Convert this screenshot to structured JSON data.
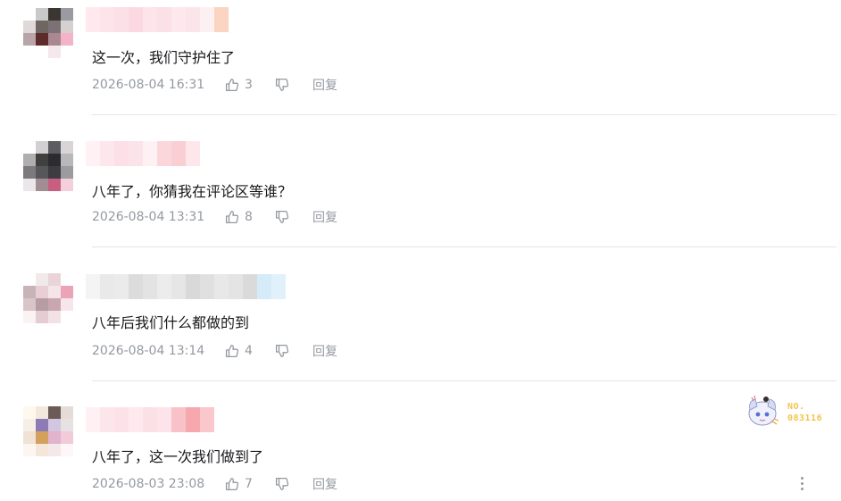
{
  "comments": [
    {
      "text": "这一次，我们守护住了",
      "time": "2026-08-04 16:31",
      "likes": "3",
      "reply_label": "回复",
      "avatar_colors": [
        "#ffffff",
        "#c9c9c9",
        "#3b3631",
        "#9a9ba0",
        "#e0d9d9",
        "#6d6661",
        "#7c7276",
        "#d6d0d1",
        "#b7a5aa",
        "#5d2c2a",
        "#a98891",
        "#f3b4c9",
        "#ffffff",
        "#ffffff",
        "#f5e8ec",
        "#ffffff"
      ],
      "name_colors": [
        "#ffe9ee",
        "#fde4ea",
        "#fbe0e8",
        "#fcd9e2",
        "#fde3ea",
        "#fce0e7",
        "#fde8ec",
        "#fbe4ea",
        "#fdf0f2",
        "#fbd4c2"
      ]
    },
    {
      "text": "八年了，你猜我在评论区等谁？",
      "time": "2026-08-04 13:31",
      "likes": "8",
      "reply_label": "回复",
      "avatar_colors": [
        "#ffffff",
        "#d2d0d2",
        "#5d5d61",
        "#d9d5d7",
        "#b0aeb1",
        "#40403f",
        "#2c2c30",
        "#b8b8ba",
        "#7c7a7d",
        "#56575a",
        "#3d3c40",
        "#9c9b9e",
        "#eae6e9",
        "#a18e93",
        "#c75f80",
        "#f4cfdc"
      ],
      "name_colors": [
        "#fff1f4",
        "#fde6ec",
        "#fcdfe7",
        "#fbe3ea",
        "#fdf1f4",
        "#fbd7dc",
        "#f9cfd4",
        "#fde7ea"
      ]
    },
    {
      "text": "八年后我们什么都做的到",
      "time": "2026-08-04 13:14",
      "likes": "4",
      "reply_label": "回复",
      "avatar_colors": [
        "#ffffff",
        "#f2e9eb",
        "#ebd3da",
        "#ffffff",
        "#c7b4b9",
        "#e7cfd5",
        "#f3e5e9",
        "#eba3b8",
        "#d9c4c8",
        "#b79ca3",
        "#c8a8ae",
        "#f6e5ea",
        "#fbf2f4",
        "#e4cdd2",
        "#f2e2e5",
        "#ffffff"
      ],
      "name_colors": [
        "#f4f4f4",
        "#e9e9e9",
        "#ebebeb",
        "#dcdcdc",
        "#e3e3e3",
        "#ececec",
        "#e6e6e6",
        "#d9d9d9",
        "#e0e0e0",
        "#e8e8e8",
        "#e4e4e4",
        "#dadada",
        "#d5ecf8",
        "#e1f1fb"
      ]
    },
    {
      "text": "八年了，这一次我们做到了",
      "time": "2026-08-03 23:08",
      "likes": "7",
      "reply_label": "回复",
      "avatar_colors": [
        "#fff8ee",
        "#f3e8dc",
        "#6b5a58",
        "#e6dcd6",
        "#f6efe6",
        "#8c7bb6",
        "#d2c6e0",
        "#e6e1e3",
        "#f0e2d4",
        "#d3a05e",
        "#e1b3cd",
        "#f3cada",
        "#fdf6f0",
        "#f4e6d8",
        "#f5e8ea",
        "#fdf7f7"
      ],
      "name_colors": [
        "#fff1f3",
        "#fde6eb",
        "#fce1e8",
        "#fde9ee",
        "#fbe0e6",
        "#fde3ea",
        "#f9c2c8",
        "#f6a8ae",
        "#f9c7cc"
      ],
      "badge_no": [
        "NO.",
        "083116"
      ]
    }
  ]
}
